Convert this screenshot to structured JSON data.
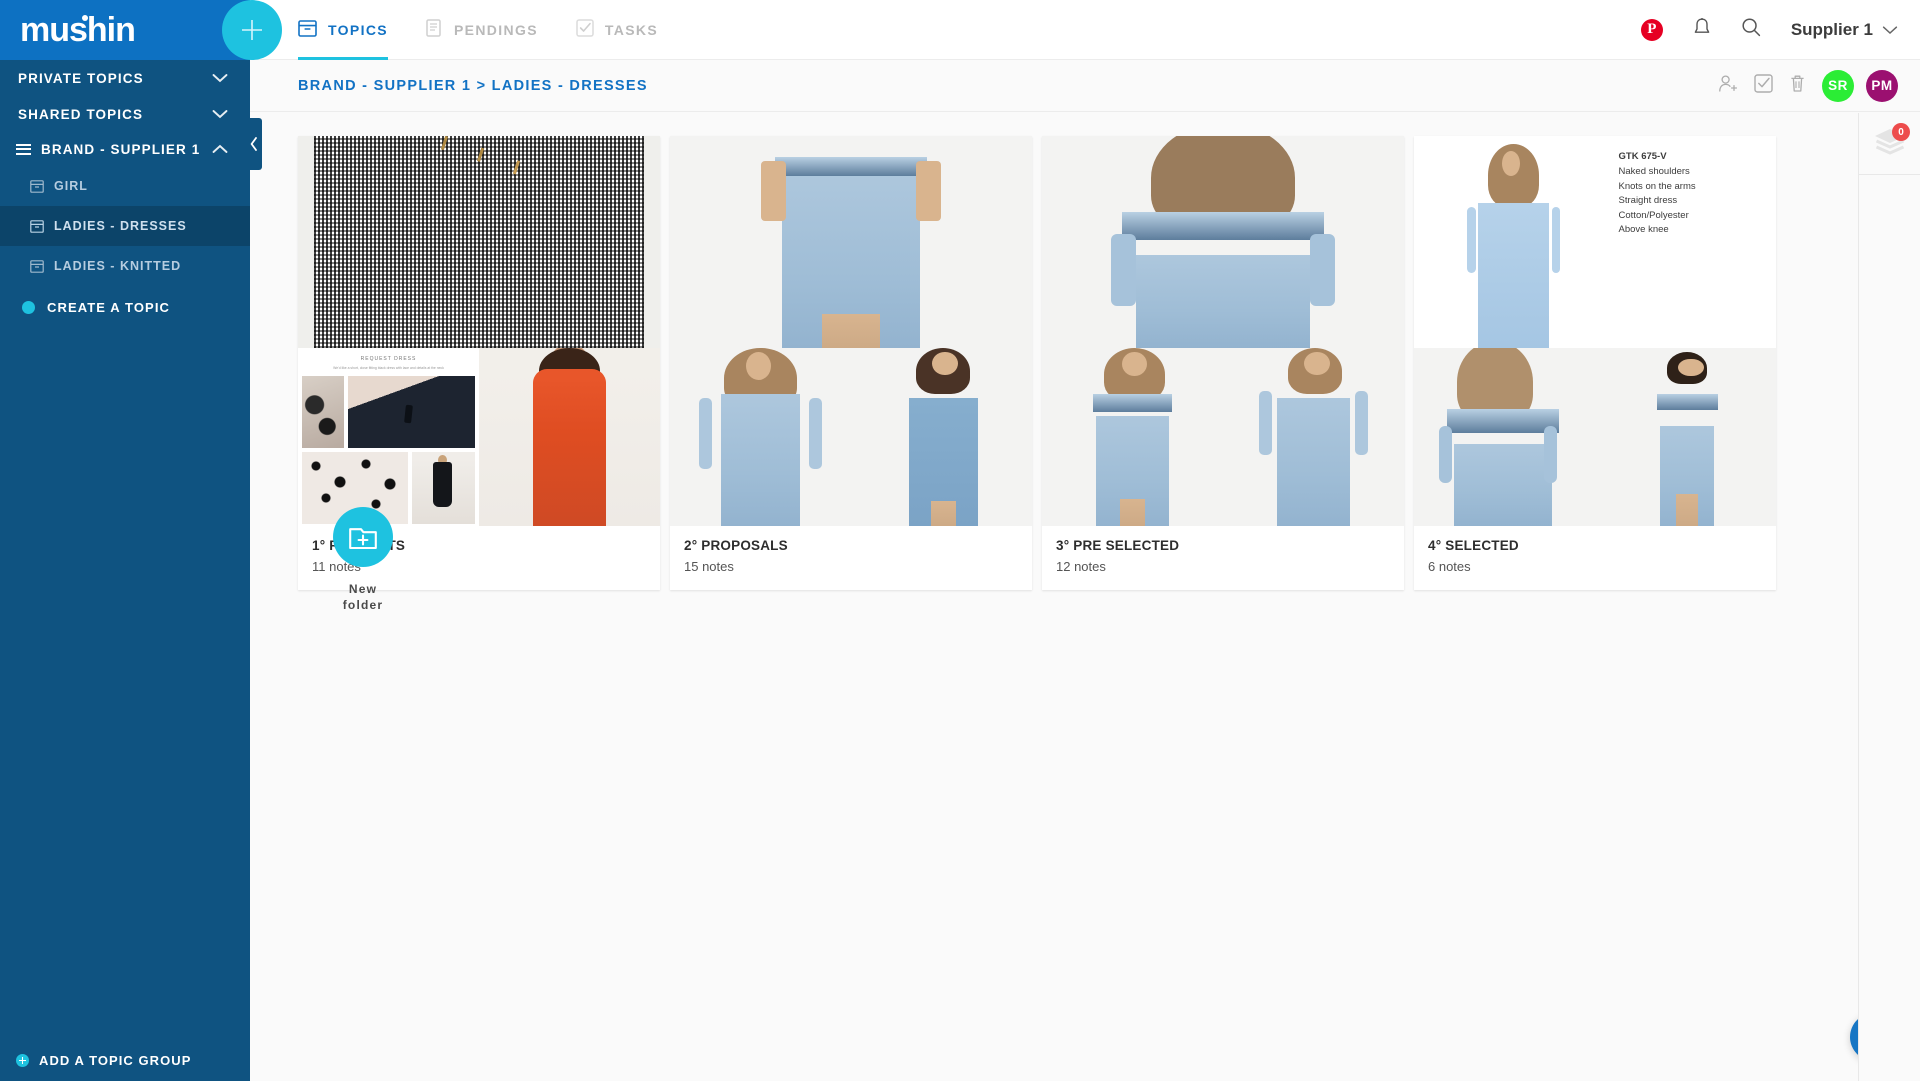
{
  "brand": {
    "name": "mushin",
    "add_button": "+"
  },
  "topnav": {
    "tabs": [
      {
        "label": "TOPICS",
        "icon": "archive-box-icon",
        "active": true
      },
      {
        "label": "PENDINGS",
        "icon": "list-icon",
        "active": false
      },
      {
        "label": "TASKS",
        "icon": "checkbox-icon",
        "active": false
      }
    ],
    "pinterest_icon": "pinterest-icon",
    "notifications_icon": "bell-icon",
    "search_icon": "search-icon",
    "user": "Supplier 1",
    "user_chevron": "chevron-down-icon"
  },
  "sidebar": {
    "sections": [
      {
        "label": "PRIVATE TOPICS",
        "icon": "chevron-down-icon",
        "expanded": false
      },
      {
        "label": "SHARED TOPICS",
        "icon": "chevron-down-icon",
        "expanded": false
      }
    ],
    "group": {
      "label": "BRAND - SUPPLIER 1",
      "drag_icon": "hamburger-icon",
      "chevron": "chevron-up-icon",
      "items": [
        {
          "label": "GIRL",
          "icon": "archive-box-icon",
          "active": false
        },
        {
          "label": "LADIES - DRESSES",
          "icon": "archive-box-icon",
          "active": true
        },
        {
          "label": "LADIES - KNITTED",
          "icon": "archive-box-icon",
          "active": false
        }
      ],
      "create": {
        "label": "CREATE A TOPIC",
        "icon": "teal-dot-icon"
      }
    },
    "footer": {
      "label": "ADD A TOPIC GROUP",
      "icon": "plus-circle-icon"
    },
    "collapse_icon": "chevron-left-icon"
  },
  "breadcrumb": {
    "text": "BRAND - SUPPLIER 1 > LADIES - DRESSES",
    "actions": [
      {
        "name": "add-member-icon",
        "label": "add-member"
      },
      {
        "name": "select-all-icon",
        "label": "select"
      },
      {
        "name": "trash-icon",
        "label": "delete"
      }
    ],
    "avatars": [
      {
        "initials": "SR",
        "color": "#2bed35"
      },
      {
        "initials": "PM",
        "color": "#9b1070"
      }
    ]
  },
  "folders": [
    {
      "title": "1° REQUESTS",
      "notes": "11 notes"
    },
    {
      "title": "2° PROPOSALS",
      "notes": "15 notes"
    },
    {
      "title": "3° PRE SELECTED",
      "notes": "12 notes"
    },
    {
      "title": "4° SELECTED",
      "notes": "6 notes"
    }
  ],
  "moodboard": {
    "title": "REQUEST DRESS",
    "subtitle": "We'd like a short, close fitting black dress with lace and details at the neck"
  },
  "spec_sheet": {
    "code": "GTK 675-V",
    "lines": [
      "Naked shoulders",
      "Knots on the arms",
      "Straight dress",
      "Cotton/Polyester",
      "Above knee"
    ]
  },
  "new_folder": {
    "line1": "New",
    "line2": "folder",
    "icon": "folder-plus-icon"
  },
  "right_rail": {
    "layers": {
      "icon": "layers-icon",
      "badge": "0"
    }
  },
  "intercom": {
    "icon": "chat-bubble-icon"
  },
  "colors": {
    "brand_blue": "#0d71c2",
    "sidebar_blue": "#0f5381",
    "accent_cyan": "#1ec2e0",
    "link_blue": "#1272c4",
    "badge_red": "#ed4c4c",
    "pinterest_red": "#e60023"
  }
}
